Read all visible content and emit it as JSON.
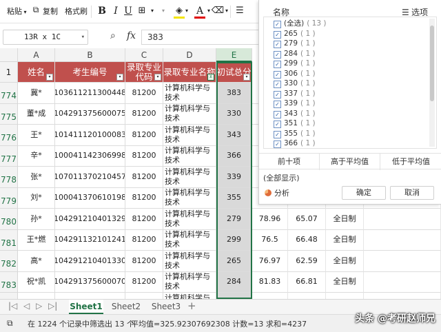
{
  "toolbar": {
    "paste": "粘贴",
    "copy": "复制",
    "format_painter": "格式刷",
    "bold": "B",
    "italic": "I",
    "underline": "U",
    "font_color_letter": "A"
  },
  "formula_bar": {
    "name_box": "13R x 1C",
    "fx": "fx",
    "value": "383"
  },
  "columns": [
    "A",
    "B",
    "C",
    "D",
    "E"
  ],
  "header_row": {
    "row_number": "1",
    "cells": [
      "姓名",
      "考生编号",
      "录取专业代码",
      "录取专业名称",
      "初试总分"
    ]
  },
  "rows": [
    {
      "n": "774",
      "name": "冀*",
      "id": "103611211300448",
      "code": "81200",
      "major": "计算机科学与技术",
      "score": "383",
      "f": "",
      "g": "",
      "h": ""
    },
    {
      "n": "775",
      "name": "董*成",
      "id": "104291375600075",
      "code": "81200",
      "major": "计算机科学与技术",
      "score": "330",
      "f": "",
      "g": "",
      "h": ""
    },
    {
      "n": "776",
      "name": "王*",
      "id": "101411120100083",
      "code": "81200",
      "major": "计算机科学与技术",
      "score": "343",
      "f": "",
      "g": "",
      "h": ""
    },
    {
      "n": "777",
      "name": "辛*",
      "id": "100041142306998",
      "code": "81200",
      "major": "计算机科学与技术",
      "score": "366",
      "f": "",
      "g": "",
      "h": ""
    },
    {
      "n": "778",
      "name": "张*",
      "id": "107011370210457",
      "code": "81200",
      "major": "计算机科学与技术",
      "score": "339",
      "f": "",
      "g": "",
      "h": ""
    },
    {
      "n": "779",
      "name": "刘*",
      "id": "100041370610198",
      "code": "81200",
      "major": "计算机科学与技术",
      "score": "355",
      "f": "",
      "g": "",
      "h": ""
    },
    {
      "n": "780",
      "name": "孙*",
      "id": "104291210401329",
      "code": "81200",
      "major": "计算机科学与技术",
      "score": "279",
      "f": "78.96",
      "g": "65.07",
      "h": "全日制"
    },
    {
      "n": "781",
      "name": "王*燃",
      "id": "104291132101241",
      "code": "81200",
      "major": "计算机科学与技术",
      "score": "299",
      "f": "76.5",
      "g": "66.48",
      "h": "全日制"
    },
    {
      "n": "782",
      "name": "高*",
      "id": "104291210401330",
      "code": "81200",
      "major": "计算机科学与技术",
      "score": "265",
      "f": "76.97",
      "g": "62.59",
      "h": "全日制"
    },
    {
      "n": "783",
      "name": "祝*凯",
      "id": "104291375600070",
      "code": "81200",
      "major": "计算机科学与技术",
      "score": "284",
      "f": "81.83",
      "g": "66.81",
      "h": "全日制"
    },
    {
      "n": "",
      "name": "",
      "id": "",
      "code": "",
      "major": "计算机科学与技术",
      "score": "",
      "f": "",
      "g": "",
      "h": ""
    }
  ],
  "filter_panel": {
    "title": "名称",
    "options_label": "选项",
    "items": [
      {
        "label": "(全选)",
        "count": "( 13 )"
      },
      {
        "label": "265",
        "count": "( 1 )"
      },
      {
        "label": "279",
        "count": "( 1 )"
      },
      {
        "label": "284",
        "count": "( 1 )"
      },
      {
        "label": "299",
        "count": "( 1 )"
      },
      {
        "label": "306",
        "count": "( 1 )"
      },
      {
        "label": "330",
        "count": "( 1 )"
      },
      {
        "label": "337",
        "count": "( 1 )"
      },
      {
        "label": "339",
        "count": "( 1 )"
      },
      {
        "label": "343",
        "count": "( 1 )"
      },
      {
        "label": "351",
        "count": "( 1 )"
      },
      {
        "label": "355",
        "count": "( 1 )"
      },
      {
        "label": "366",
        "count": "( 1 )"
      }
    ],
    "stats": [
      "前十项",
      "高于平均值",
      "低于平均值"
    ],
    "show_all": "(全部显示)",
    "analyze": "分析",
    "ok": "确定",
    "cancel": "取消"
  },
  "sheets": [
    "Sheet1",
    "Sheet2",
    "Sheet3"
  ],
  "status": {
    "filter_info": "在 1224 个记录中筛选出 13 个",
    "summary": "平均值=325.92307692308 计数=13 求和=4237"
  },
  "watermark": "头条 @考研赵师兄",
  "colors": {
    "header_fill": "#c0504d",
    "accent_green": "#217346",
    "selection_gray": "#d9d9d9"
  }
}
